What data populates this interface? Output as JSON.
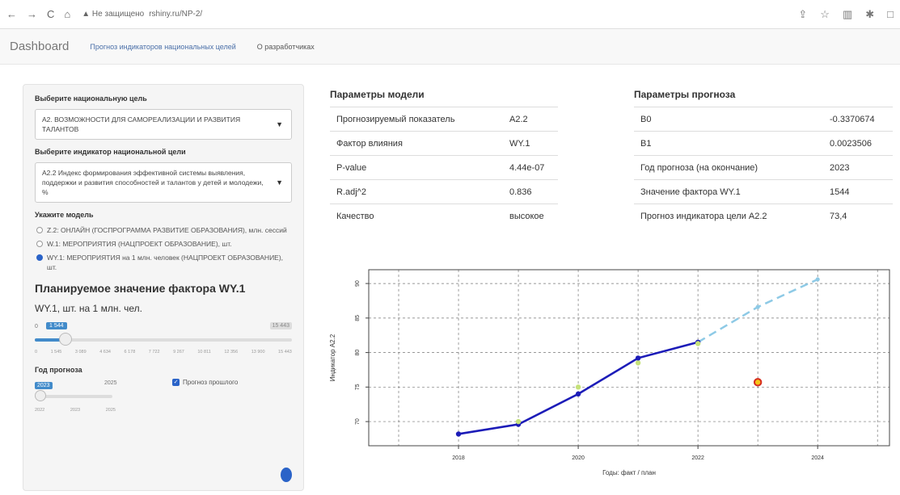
{
  "browser": {
    "nav_buttons": [
      "←",
      "→",
      "C",
      "⌂"
    ],
    "security": "▲ Не защищено",
    "url": "rshiny.ru/NP-2/",
    "right_icons": [
      "⇪",
      "☆",
      "▥",
      "✱",
      "□"
    ]
  },
  "navbar": {
    "brand": "Dashboard",
    "tab_forecast": "Прогноз индикаторов национальных целей",
    "tab_about": "О разработчиках"
  },
  "sidebar": {
    "goal_label": "Выберите национальную цель",
    "goal_value": "А2. ВОЗМОЖНОСТИ ДЛЯ САМОРЕАЛИЗАЦИИ И РАЗВИТИЯ ТАЛАНТОВ",
    "indicator_label": "Выберите индикатор национальной цели",
    "indicator_value": "А2.2 Индекс формирования эффективной системы выявления, поддержки и развития способностей и талантов у детей и молодежи, %",
    "model_label": "Укажите модель",
    "models": [
      {
        "label": "Z.2: ОНЛАЙН (ГОСПРОГРАММА РАЗВИТИЕ ОБРАЗОВАНИЯ), млн. сессий",
        "selected": false
      },
      {
        "label": "W.1: МЕРОПРИЯТИЯ (НАЦПРОЕКТ ОБРАЗОВАНИЕ), шт.",
        "selected": false
      },
      {
        "label": "WY.1: МЕРОПРИЯТИЯ на 1 млн. человек (НАЦПРОЕКТ ОБРАЗОВАНИЕ), шт.",
        "selected": true
      }
    ],
    "planned_title": "Планируемое значение фактора WY.1",
    "planned_unit": "WY.1, шт. на 1 млн. чел.",
    "factor_slider": {
      "min": "0",
      "value": "1 544",
      "max": "15 443",
      "ticks": [
        "0",
        "1 545",
        "3 089",
        "4 634",
        "6 178",
        "7 722",
        "9 267",
        "10 811",
        "12 356",
        "13 900",
        "15 443"
      ]
    },
    "year_label": "Год прогноза",
    "year_slider": {
      "value": "2023",
      "max": "2025",
      "ticks": [
        "2022",
        "2023",
        "2025"
      ]
    },
    "show_past_label": "Прогноз прошлого",
    "show_past_checked": true
  },
  "model_params": {
    "title": "Параметры модели",
    "rows": [
      [
        "Прогнозируемый показатель",
        "А2.2"
      ],
      [
        "Фактор влияния",
        "WY.1"
      ],
      [
        "P-value",
        "4.44e-07"
      ],
      [
        "R.adj^2",
        "0.836"
      ],
      [
        "Качество",
        "высокое"
      ]
    ]
  },
  "forecast_params": {
    "title": "Параметры прогноза",
    "rows": [
      [
        "B0",
        "-0.3370674"
      ],
      [
        "B1",
        "0.0023506"
      ],
      [
        "Год прогноза (на окончание)",
        "2023"
      ],
      [
        "Значение фактора WY.1",
        "1544"
      ],
      [
        "Прогноз индикатора цели А2.2",
        "73,4"
      ]
    ]
  },
  "chart_data": {
    "type": "line",
    "xlabel": "Годы: факт / план",
    "ylabel": "Индикатор А2.2",
    "xlim": [
      2016.5,
      2025.2
    ],
    "ylim": [
      66.5,
      92
    ],
    "xticks": [
      2018,
      2020,
      2022,
      2024
    ],
    "yticks": [
      65,
      70,
      75,
      80,
      85,
      90
    ],
    "grid": true,
    "colors": {
      "fact": "#1c1cb8",
      "plan": "#8ecae6",
      "fitted": "#c5e17a",
      "forecast_fill": "#f5c518",
      "forecast_edge": "#d62b1f"
    },
    "series": [
      {
        "x": [
          2018,
          2019,
          2020,
          2021,
          2022
        ],
        "y": [
          68.2,
          69.6,
          74.0,
          79.2,
          81.5
        ]
      },
      {
        "x": [
          2022,
          2023,
          2024
        ],
        "y": [
          81.5,
          86.6,
          90.6
        ]
      },
      {
        "x": [
          2019,
          2020,
          2021,
          2022
        ],
        "y": [
          70.0,
          75.0,
          78.5,
          81.3
        ]
      },
      {
        "x": [
          2023
        ],
        "y": [
          75.7
        ]
      }
    ]
  }
}
